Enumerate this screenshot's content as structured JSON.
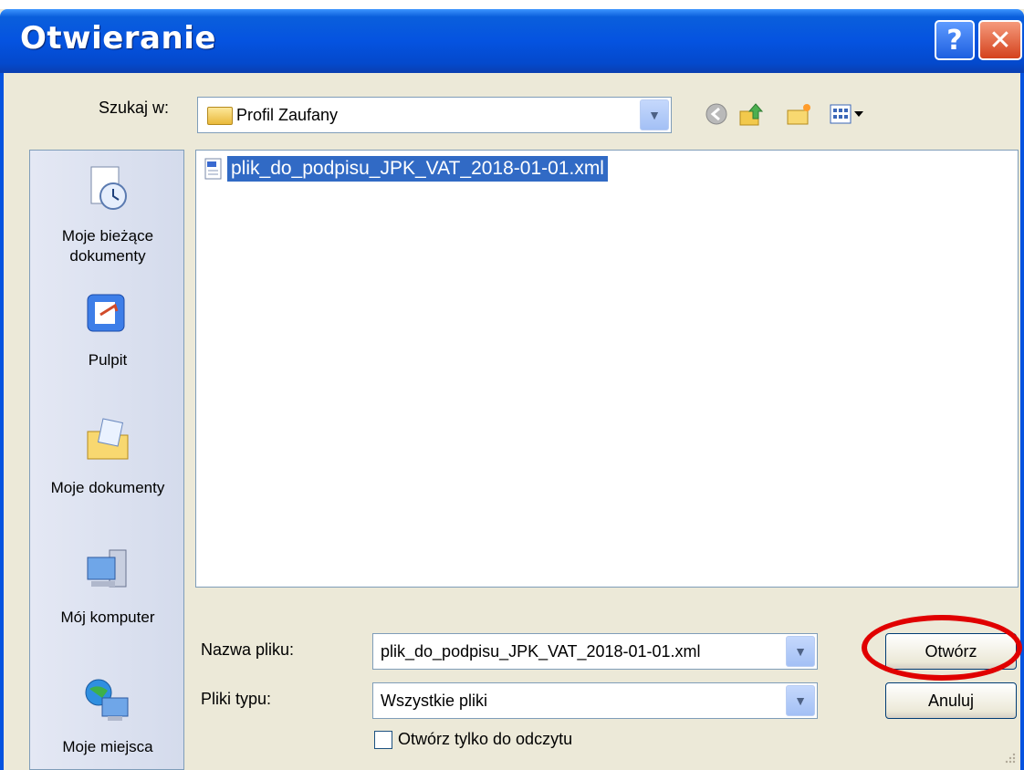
{
  "dialog": {
    "title": "Otwieranie",
    "help_label": "?",
    "close_label": "✕"
  },
  "lookin": {
    "label": "Szukaj w:",
    "value": "Profil Zaufany"
  },
  "places": [
    {
      "line1": "Moje bieżące",
      "line2": "dokumenty",
      "icon": "recent-documents-icon"
    },
    {
      "line1": "Pulpit",
      "line2": "",
      "icon": "desktop-icon"
    },
    {
      "line1": "Moje dokumenty",
      "line2": "",
      "icon": "my-documents-icon"
    },
    {
      "line1": "Mój komputer",
      "line2": "",
      "icon": "my-computer-icon"
    },
    {
      "line1": "Moje miejsca",
      "line2": "",
      "icon": "network-places-icon"
    }
  ],
  "files": [
    {
      "name": "plik_do_podpisu_JPK_VAT_2018-01-01.xml",
      "selected": true
    }
  ],
  "filename": {
    "label": "Nazwa pliku:",
    "value": "plik_do_podpisu_JPK_VAT_2018-01-01.xml"
  },
  "filetype": {
    "label": "Pliki typu:",
    "value": "Wszystkie pliki"
  },
  "buttons": {
    "open": "Otwórz",
    "cancel": "Anuluj"
  },
  "readonly": {
    "label": "Otwórz tylko do odczytu",
    "checked": false
  },
  "colors": {
    "titlebar": "#0553e0",
    "selection": "#316ac5",
    "highlight_circle": "#e00000"
  }
}
